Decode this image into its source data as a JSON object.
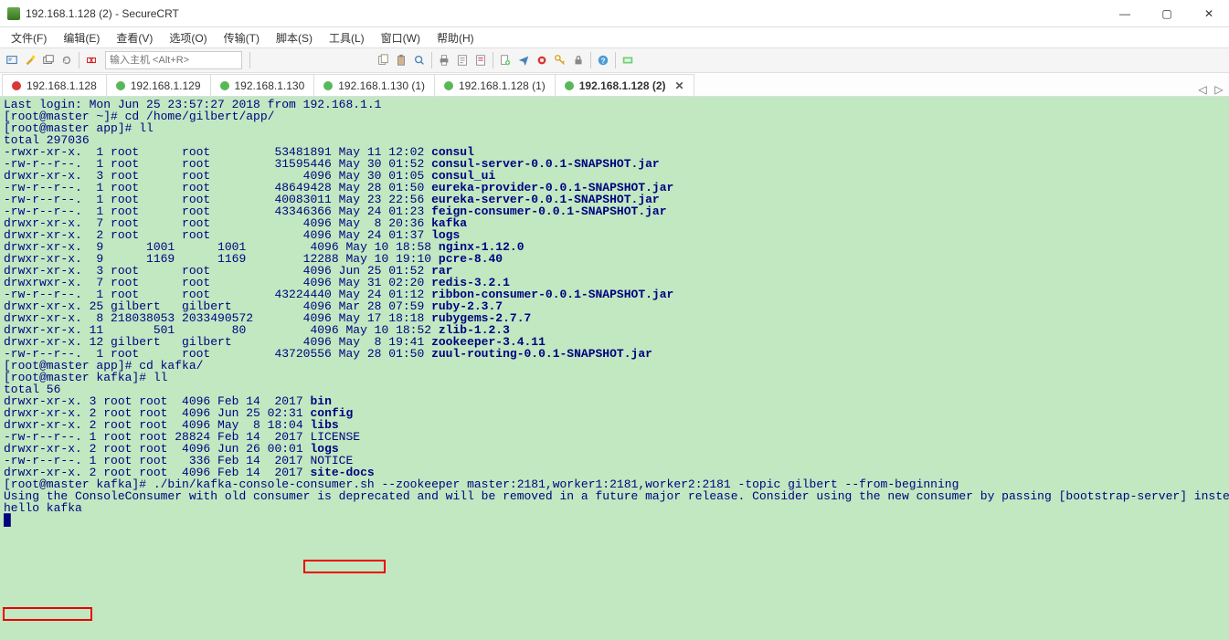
{
  "window": {
    "title": "192.168.1.128 (2) - SecureCRT",
    "min": "—",
    "max": "▢",
    "close": "✕"
  },
  "menu": {
    "file": "文件(F)",
    "edit": "编辑(E)",
    "view": "查看(V)",
    "option": "选项(O)",
    "transfer": "传输(T)",
    "script": "脚本(S)",
    "tools": "工具(L)",
    "window": "窗口(W)",
    "help": "帮助(H)"
  },
  "toolbar": {
    "host_placeholder": "输入主机 <Alt+R>"
  },
  "tabs": [
    {
      "label": "192.168.1.128",
      "status": "red"
    },
    {
      "label": "192.168.1.129",
      "status": "green"
    },
    {
      "label": "192.168.1.130",
      "status": "green"
    },
    {
      "label": "192.168.1.130 (1)",
      "status": "green"
    },
    {
      "label": "192.168.1.128 (1)",
      "status": "green"
    },
    {
      "label": "192.168.1.128 (2)",
      "status": "green",
      "active": true,
      "closable": true
    }
  ],
  "term": {
    "l1": "Last login: Mon Jun 25 23:57:27 2018 from 192.168.1.1",
    "l2": "[root@master ~]# cd /home/gilbert/app/",
    "l3": "[root@master app]# ll",
    "l4": "total 297036",
    "r1a": "-rwxr-xr-x.  1 root      root         53481891 May 11 12:02 ",
    "r1b": "consul",
    "r2a": "-rw-r--r--.  1 root      root         31595446 May 30 01:52 ",
    "r2b": "consul-server-0.0.1-SNAPSHOT.jar",
    "r3a": "drwxr-xr-x.  3 root      root             4096 May 30 01:05 ",
    "r3b": "consul_ui",
    "r4a": "-rw-r--r--.  1 root      root         48649428 May 28 01:50 ",
    "r4b": "eureka-provider-0.0.1-SNAPSHOT.jar",
    "r5a": "-rw-r--r--.  1 root      root         40083011 May 23 22:56 ",
    "r5b": "eureka-server-0.0.1-SNAPSHOT.jar",
    "r6a": "-rw-r--r--.  1 root      root         43346366 May 24 01:23 ",
    "r6b": "feign-consumer-0.0.1-SNAPSHOT.jar",
    "r7a": "drwxr-xr-x.  7 root      root             4096 May  8 20:36 ",
    "r7b": "kafka",
    "r8a": "drwxr-xr-x.  2 root      root             4096 May 24 01:37 ",
    "r8b": "logs",
    "r9a": "drwxr-xr-x.  9      1001      1001         4096 May 10 18:58 ",
    "r9b": "nginx-1.12.0",
    "r10a": "drwxr-xr-x.  9      1169      1169        12288 May 10 19:10 ",
    "r10b": "pcre-8.40",
    "r11a": "drwxr-xr-x.  3 root      root             4096 Jun 25 01:52 ",
    "r11b": "rar",
    "r12a": "drwxrwxr-x.  7 root      root             4096 May 31 02:20 ",
    "r12b": "redis-3.2.1",
    "r13a": "-rw-r--r--.  1 root      root         43224440 May 24 01:12 ",
    "r13b": "ribbon-consumer-0.0.1-SNAPSHOT.jar",
    "r14a": "drwxr-xr-x. 25 gilbert   gilbert          4096 Mar 28 07:59 ",
    "r14b": "ruby-2.3.7",
    "r15a": "drwxr-xr-x.  8 218038053 2033490572       4096 May 17 18:18 ",
    "r15b": "rubygems-2.7.7",
    "r16a": "drwxr-xr-x. 11       501        80         4096 May 10 18:52 ",
    "r16b": "zlib-1.2.3",
    "r17a": "drwxr-xr-x. 12 gilbert   gilbert          4096 May  8 19:41 ",
    "r17b": "zookeeper-3.4.11",
    "r18a": "-rw-r--r--.  1 root      root         43720556 May 28 01:50 ",
    "r18b": "zuul-routing-0.0.1-SNAPSHOT.jar",
    "l5": "[root@master app]# cd kafka/",
    "l6": "[root@master kafka]# ll",
    "l7": "total 56",
    "k1a": "drwxr-xr-x. 3 root root  4096 Feb 14  2017 ",
    "k1b": "bin",
    "k2a": "drwxr-xr-x. 2 root root  4096 Jun 25 02:31 ",
    "k2b": "config",
    "k3a": "drwxr-xr-x. 2 root root  4096 May  8 18:04 ",
    "k3b": "libs",
    "k4": "-rw-r--r--. 1 root root 28824 Feb 14  2017 LICENSE",
    "k5a": "drwxr-xr-x. 2 root root  4096 Jun 26 00:01 ",
    "k5b": "logs",
    "k6": "-rw-r--r--. 1 root root   336 Feb 14  2017 NOTICE",
    "k7a": "drwxr-xr-x. 2 root root  4096 Feb 14  2017 ",
    "k7b": "site-docs",
    "cmd": "[root@master kafka]# ./bin/kafka-console-consumer.sh --zookeeper master:2181,worker1:2181,worker2:2181 -topic gilbert --from-beginning",
    "warn": "Using the ConsoleConsumer with old consumer is deprecated and will be removed in a future major release. Consider using the new consumer by passing [bootstrap-server] instead of [zookeeper].",
    "out": "hello kafka",
    "cursor": "█"
  }
}
